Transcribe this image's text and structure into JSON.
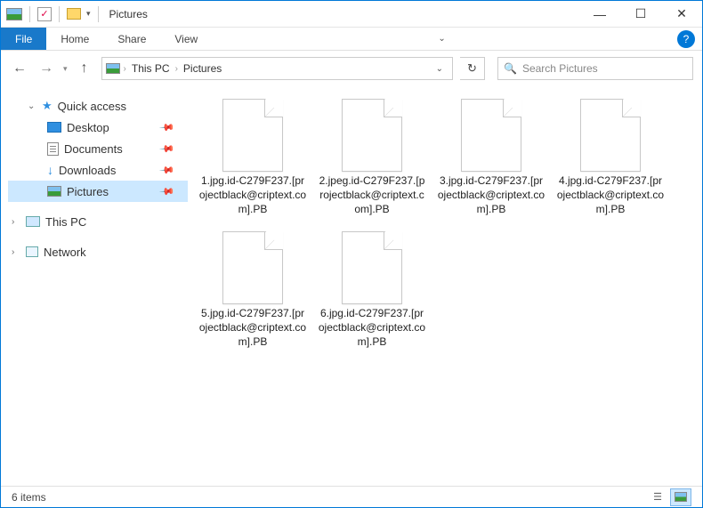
{
  "window": {
    "title": "Pictures"
  },
  "ribbon": {
    "file": "File",
    "tabs": [
      "Home",
      "Share",
      "View"
    ]
  },
  "breadcrumb": [
    "This PC",
    "Pictures"
  ],
  "search": {
    "placeholder": "Search Pictures"
  },
  "sidebar": {
    "quick_access": "Quick access",
    "items": [
      "Desktop",
      "Documents",
      "Downloads",
      "Pictures"
    ],
    "this_pc": "This PC",
    "network": "Network"
  },
  "files": [
    "1.jpg.id-C279F237.[projectblack@criptext.com].PB",
    "2.jpeg.id-C279F237.[projectblack@criptext.com].PB",
    "3.jpg.id-C279F237.[projectblack@criptext.com].PB",
    "4.jpg.id-C279F237.[projectblack@criptext.com].PB",
    "5.jpg.id-C279F237.[projectblack@criptext.com].PB",
    "6.jpg.id-C279F237.[projectblack@criptext.com].PB"
  ],
  "status": {
    "count": "6 items"
  }
}
